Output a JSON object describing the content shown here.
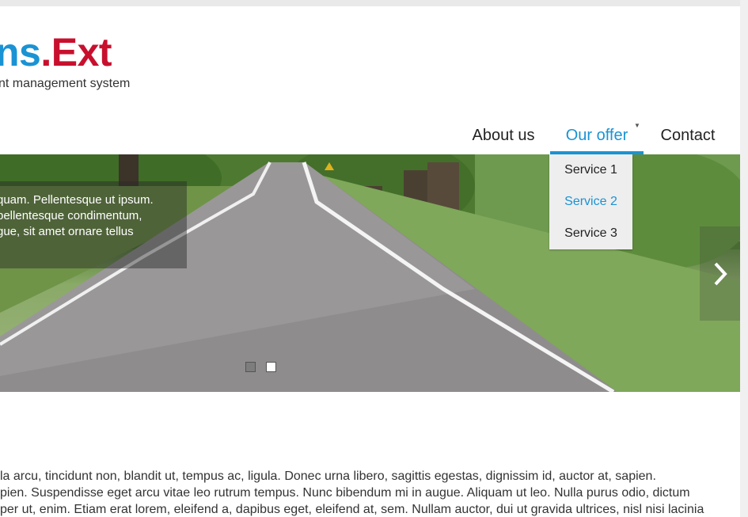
{
  "header": {
    "logo_part1": "ns",
    "logo_dot": ".",
    "logo_part2": "Ext",
    "tagline": "nt management system"
  },
  "nav": {
    "items": [
      {
        "label": "About us"
      },
      {
        "label": "Our offer"
      },
      {
        "label": "Contact"
      }
    ],
    "dropdown": [
      {
        "label": "Service 1"
      },
      {
        "label": "Service 2"
      },
      {
        "label": "Service 3"
      }
    ],
    "caret": "▼"
  },
  "slider": {
    "caption_lines": [
      "quam. Pellentesque ut ipsum.",
      "pellentesque condimentum,",
      "gue, sit amet ornare tellus"
    ],
    "slide_count": 2,
    "active_slide": 1
  },
  "content": {
    "lines": [
      "la arcu, tincidunt non, blandit ut, tempus ac, ligula. Donec urna libero, sagittis egestas, dignissim id, auctor at, sapien.",
      "pien. Suspendisse eget arcu vitae leo rutrum tempus. Nunc bibendum mi in augue. Aliquam ut leo. Nulla purus odio, dictum",
      "per ut, enim. Etiam erat lorem, eleifend a, dapibus eget, eleifend at, sem. Nullam auctor, dui ut gravida ultrices, nisl nisi lacinia"
    ]
  },
  "colors": {
    "brand_blue": "#1a93d4",
    "brand_red": "#c8102e"
  },
  "icons": {
    "next": "chevron-right-icon"
  }
}
